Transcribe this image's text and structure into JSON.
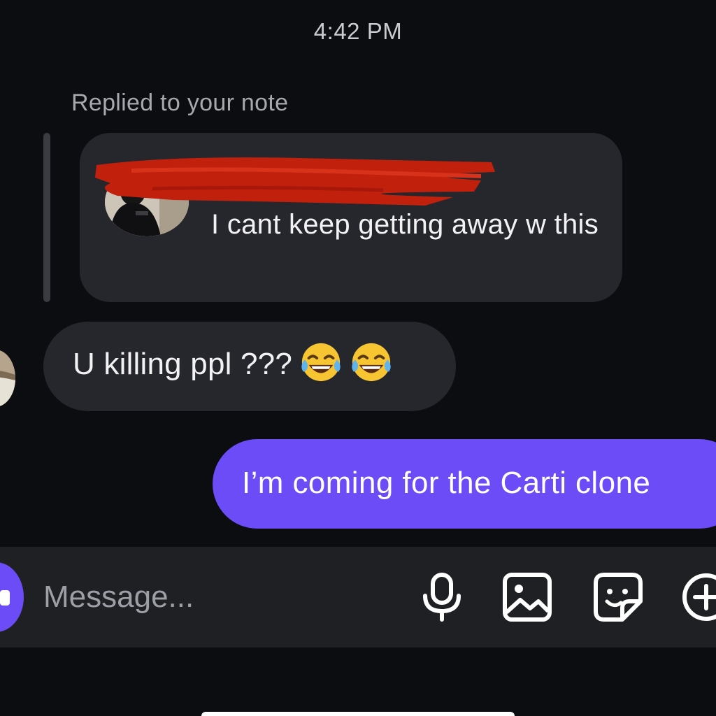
{
  "thread": {
    "timestamp": "4:42 PM"
  },
  "note_reply": {
    "label": "Replied to your note",
    "note_text": "I cant keep getting away w this"
  },
  "messages": [
    {
      "direction": "incoming",
      "text": "U killing ppl ???",
      "emojis": [
        "face-with-tears-of-joy",
        "face-with-tears-of-joy"
      ]
    },
    {
      "direction": "outgoing",
      "text": "I’m coming for the Carti clone"
    }
  ],
  "composer": {
    "placeholder": "Message...",
    "icons": [
      "camera-icon",
      "microphone-icon",
      "gallery-icon",
      "sticker-icon",
      "add-icon"
    ]
  },
  "colors": {
    "background": "#0c0d11",
    "incoming_bubble": "#26272c",
    "outgoing_bubble": "#6b4cf6",
    "composer_bar": "#1f2024",
    "redaction": "#c0200c"
  }
}
